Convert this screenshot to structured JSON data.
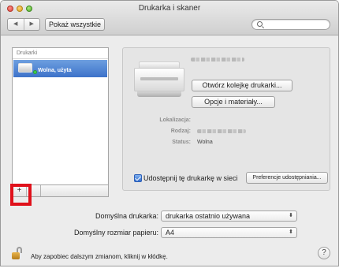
{
  "window": {
    "title": "Drukarka i skaner"
  },
  "toolbar": {
    "back_glyph": "◀",
    "forward_glyph": "▶",
    "show_all_label": "Pokaż wszystkie",
    "search_placeholder": ""
  },
  "printers_list": {
    "header": "Drukarki",
    "items": [
      {
        "status_label": "Wolna, użyta"
      }
    ],
    "add_label": "+",
    "remove_label": ""
  },
  "detail": {
    "open_queue_label": "Otwórz kolejkę drukarki...",
    "options_label": "Opcje i materiały...",
    "location_label": "Lokalizacja:",
    "kind_label": "Rodzaj:",
    "status_label": "Status:",
    "status_value": "Wolna",
    "share_label": "Udostępnij tę drukarkę w sieci",
    "share_checked": true,
    "share_prefs_label": "Preferencje udostępniania..."
  },
  "defaults": {
    "default_printer_label": "Domyślna drukarka:",
    "default_printer_value": "drukarka ostatnio używana",
    "paper_size_label": "Domyślny rozmiar papieru:",
    "paper_size_value": "A4",
    "select_arrows": "⬍"
  },
  "footer": {
    "lock_text": "Aby zapobiec dalszym zmianom, kliknij w kłódkę.",
    "help_label": "?"
  },
  "colors": {
    "selection": "#3d72c9",
    "highlight_box": "#e0111b",
    "status_dot": "#3fd04a"
  }
}
